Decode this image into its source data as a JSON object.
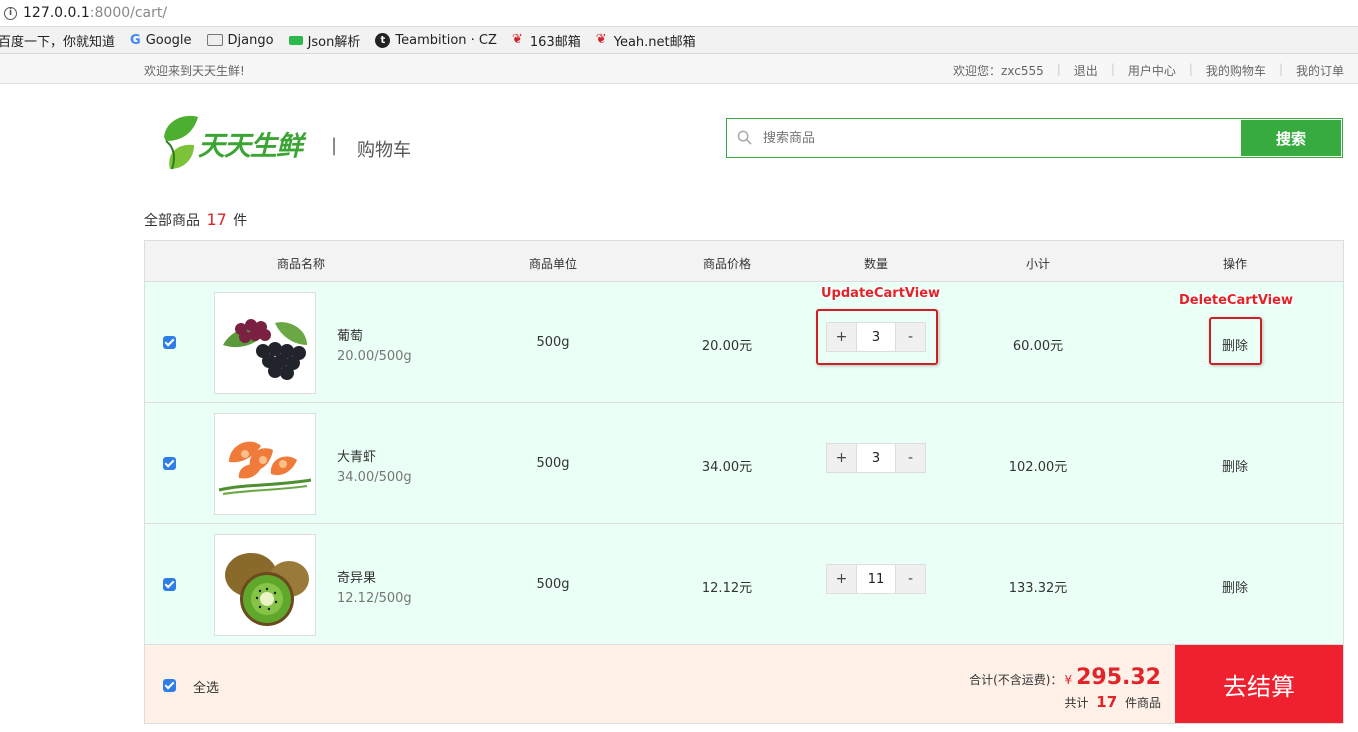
{
  "browser": {
    "url_host": "127.0.0.1",
    "url_rest": ":8000/cart/",
    "bookmarks": [
      {
        "label": "百度一下，你就知道",
        "icon": "none"
      },
      {
        "label": "Google",
        "icon": "google-icon"
      },
      {
        "label": "Django",
        "icon": "folder-icon"
      },
      {
        "label": "Json解析",
        "icon": "json-icon"
      },
      {
        "label": "Teambition · CZ",
        "icon": "teambition-icon"
      },
      {
        "label": "163邮箱",
        "icon": "mail-icon"
      },
      {
        "label": "Yeah.net邮箱",
        "icon": "mail-icon"
      }
    ]
  },
  "topbar": {
    "welcome": "欢迎来到天天生鲜!",
    "user": "欢迎您：zxc555",
    "logout": "退出",
    "user_center": "用户中心",
    "my_cart": "我的购物车",
    "my_orders": "我的订单"
  },
  "header": {
    "logo_text": "天天生鲜",
    "separator": "|",
    "page_name": "购物车",
    "search_placeholder": "搜索商品",
    "search_button": "搜索"
  },
  "cart": {
    "total_prefix": "全部商品",
    "total_count": "17",
    "total_suffix": "件",
    "columns": [
      "商品名称",
      "商品单位",
      "商品价格",
      "数量",
      "小计",
      "操作"
    ],
    "items": [
      {
        "name": "葡萄",
        "unit_price": "20.00/500g",
        "unit": "500g",
        "price": "20.00元",
        "qty": "3",
        "subtotal": "60.00元",
        "action": "删除",
        "image": "grape-image"
      },
      {
        "name": "大青虾",
        "unit_price": "34.00/500g",
        "unit": "500g",
        "price": "34.00元",
        "qty": "3",
        "subtotal": "102.00元",
        "action": "删除",
        "image": "shrimp-image"
      },
      {
        "name": "奇异果",
        "unit_price": "12.12/500g",
        "unit": "500g",
        "price": "12.12元",
        "qty": "11",
        "subtotal": "133.32元",
        "action": "删除",
        "image": "kiwi-image"
      }
    ],
    "plus": "+",
    "minus": "-",
    "select_all": "全选",
    "sum_label": "合计(不含运费)：",
    "currency": "¥",
    "sum_amount": "295.32",
    "count_prefix": "共计",
    "count_value": "17",
    "count_suffix": "件商品",
    "checkout": "去结算"
  },
  "annotations": {
    "update": "UpdateCartView",
    "delete": "DeleteCartView"
  },
  "colors": {
    "brand_green": "#37ab40",
    "accent_red": "#e0242a",
    "checkout_red": "#f0212f",
    "row_bg": "#eafff6",
    "footer_bg": "#fff1e8"
  }
}
